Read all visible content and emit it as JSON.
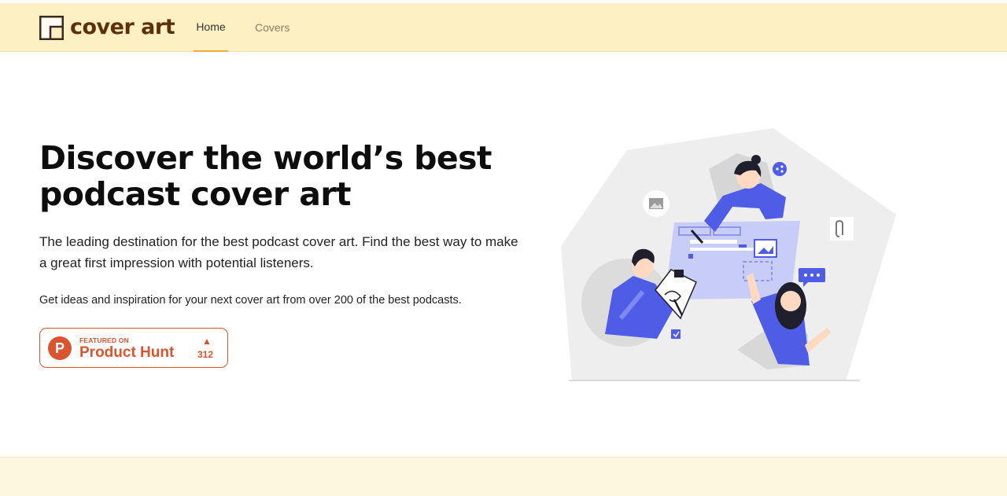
{
  "brand": {
    "name": "cover art"
  },
  "nav": {
    "home": "Home",
    "covers": "Covers"
  },
  "hero": {
    "title": "Discover the world’s best podcast cover art",
    "subtitle": "The leading destination for the best podcast cover art. Find the best way to make a great first impression with potential listeners.",
    "note": "Get ideas and inspiration for your next cover art from over 200 of the best podcasts."
  },
  "product_hunt": {
    "letter": "P",
    "featured": "FEATURED ON",
    "name": "Product Hunt",
    "arrow": "▲",
    "count": "312"
  },
  "colors": {
    "navbar": "#fdf1c4",
    "brand_text": "#5e2f0d",
    "active_tab": "#f0a93a",
    "product_hunt": "#da552f",
    "illustration_blue": "#4f5ce6",
    "footer": "#fef7df"
  },
  "icons": {
    "logo": "cover-art-logo-icon",
    "illustration": "team-collaboration-illustration",
    "share": "share-icon",
    "image": "image-icon",
    "attachment": "paperclip-icon",
    "chat": "chat-bubble-icon",
    "check": "checkbox-icon"
  }
}
